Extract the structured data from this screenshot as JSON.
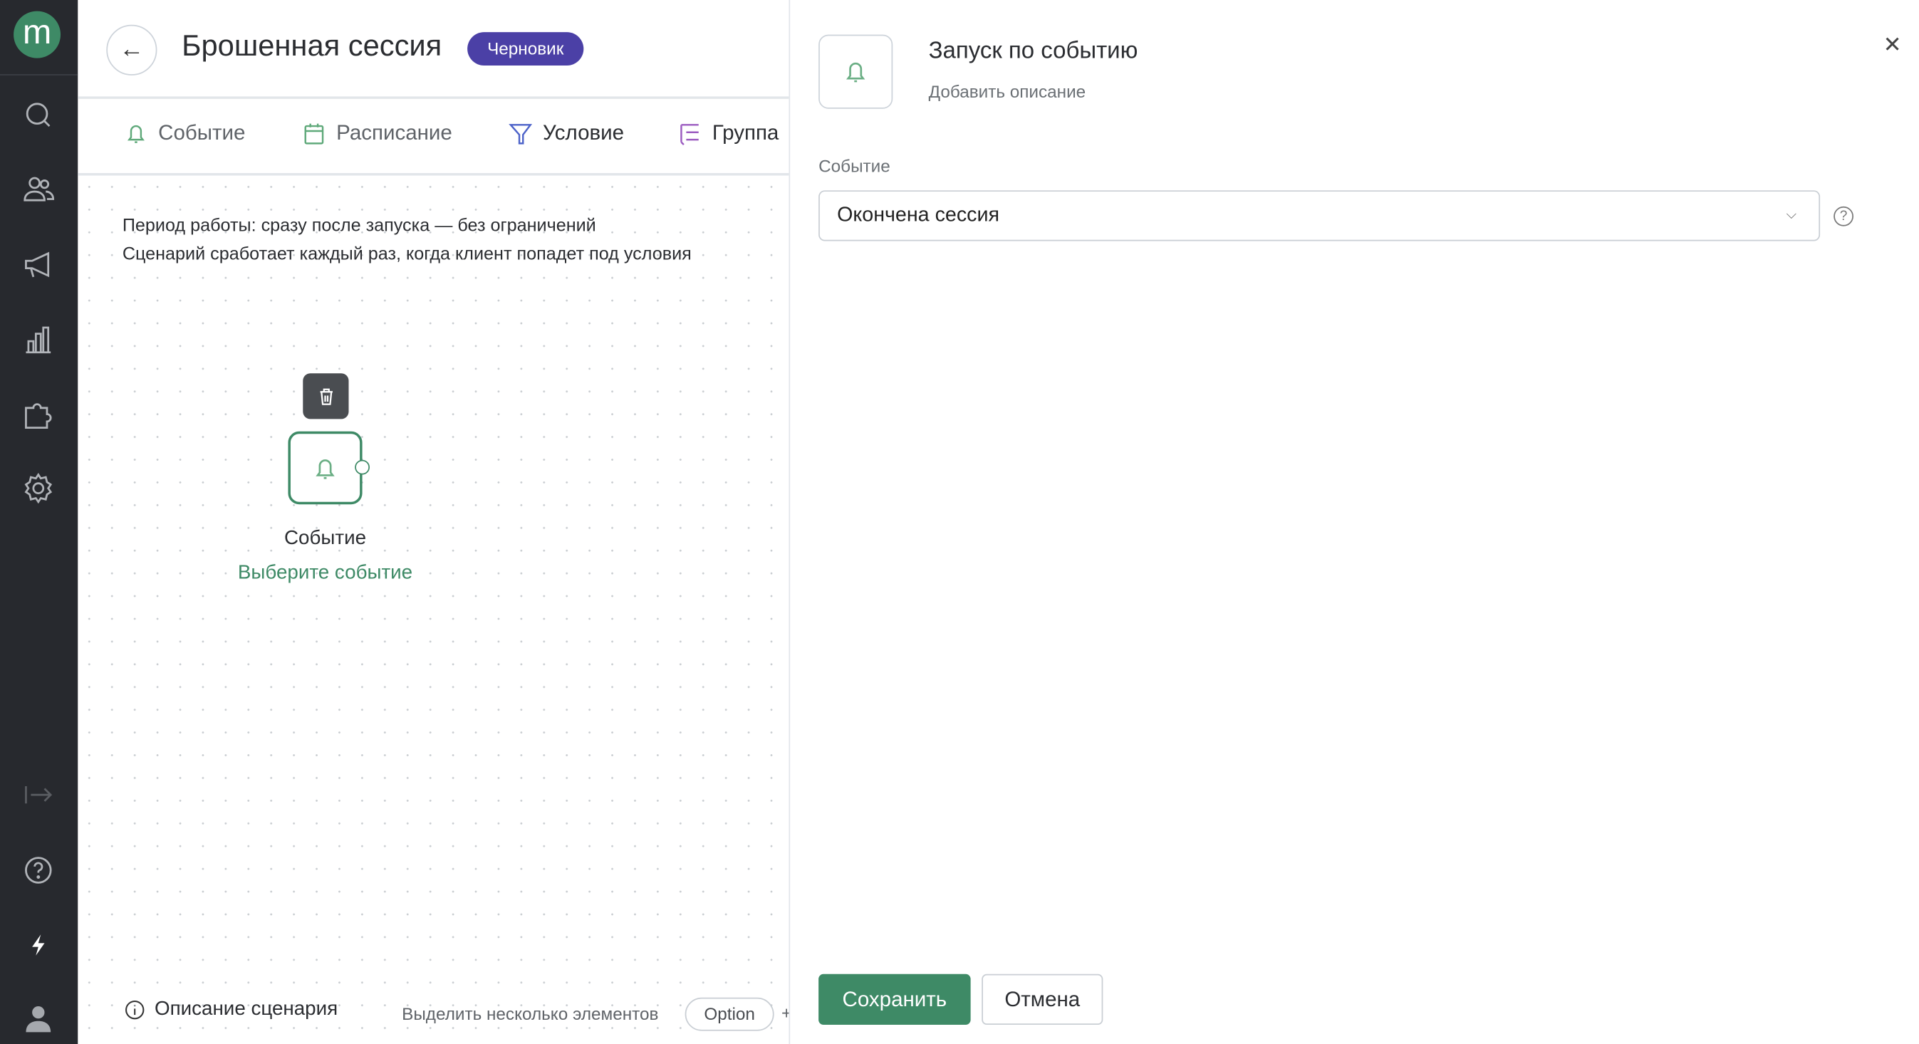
{
  "sidebar": {
    "logo": "m",
    "top_icons": [
      "search-icon",
      "users-icon",
      "megaphone-icon",
      "chart-icon",
      "puzzle-icon",
      "gear-icon"
    ],
    "bottom_icons": [
      "expand-icon",
      "help-icon",
      "bolt-icon",
      "user-icon"
    ]
  },
  "header": {
    "title": "Брошенная сессия",
    "badge": "Черновик",
    "badge_color": "#4b40a6"
  },
  "tabs": [
    {
      "label": "Событие",
      "icon": "bell-icon",
      "color": "#5fa97a"
    },
    {
      "label": "Расписание",
      "icon": "calendar-icon",
      "color": "#5fa97a"
    },
    {
      "label": "Условие",
      "icon": "filter-icon",
      "color": "#4d63c9"
    },
    {
      "label": "Группа",
      "icon": "group-icon",
      "color": "#9b5bc0"
    }
  ],
  "canvas": {
    "info_line1": "Период работы: сразу после запуска — без ограничений",
    "info_line2": "Сценарий сработает каждый раз, когда клиент попадет под условия",
    "node": {
      "title": "Событие",
      "subtitle": "Выберите событие"
    }
  },
  "footer": {
    "description": "Описание сценария",
    "hint": "Выделить несколько элементов",
    "key": "Option",
    "plus": "+"
  },
  "panel": {
    "title": "Запуск по событию",
    "description": "Добавить описание",
    "field_label": "Событие",
    "field_value": "Окончена сессия",
    "save": "Сохранить",
    "cancel": "Отмена",
    "accent": "#3e8a66"
  }
}
